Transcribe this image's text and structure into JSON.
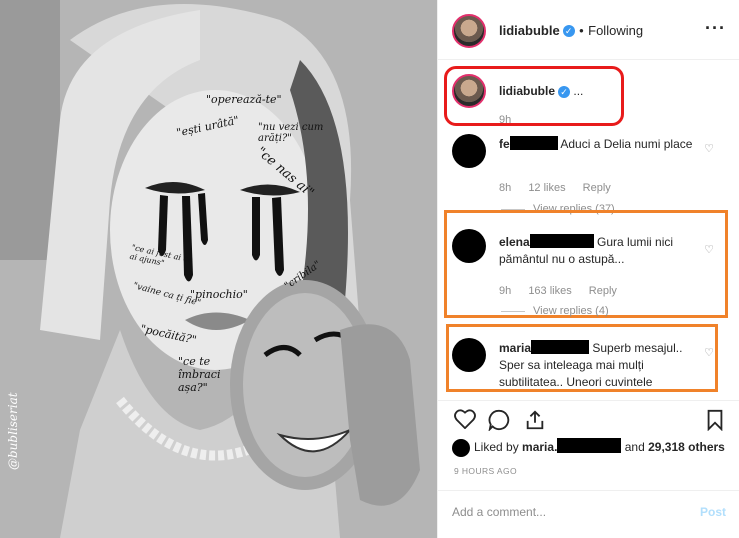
{
  "photo": {
    "face_text": [
      "\"operează-te\"",
      "\"ești urâtă\"",
      "\"nu vezi cum arăți?\"",
      "\"ce nas ai\"",
      "\"ce ai fost ai ce ai ajuns\"",
      "\"vaine ca ți fie\"",
      "\"pinochio\"",
      "\"cribila\"",
      "\"pocăită?\"",
      "\"ce te îmbraci așa?\""
    ],
    "watermark": "@bubliseriat"
  },
  "header": {
    "username": "lidiabuble",
    "separator": "•",
    "following": "Following",
    "more_icon": "more-horizontal-icon"
  },
  "caption": {
    "username": "lidiabuble",
    "text": "...",
    "time": "9h"
  },
  "comments": [
    {
      "user": "fe",
      "text": "Aduci a Delia numi place",
      "time": "8h",
      "likes": "12 likes",
      "reply": "Reply",
      "view_replies": "View replies (37)"
    },
    {
      "user": "elena",
      "text": "Gura lumii nici pământul nu o astupă...",
      "time": "9h",
      "likes": "163 likes",
      "reply": "Reply",
      "view_replies": "View replies (4)"
    },
    {
      "user": "maria",
      "text": "Superb mesajul.. Sper sa inteleaga mai mulți subtilitatea.. Uneori cuvintele"
    }
  ],
  "actions": {
    "like_icon": "heart-icon",
    "comment_icon": "comment-icon",
    "share_icon": "share-icon",
    "save_icon": "bookmark-icon"
  },
  "likes": {
    "prefix": "Liked by",
    "user": "maria.",
    "and": "and",
    "others": "29,318 others"
  },
  "time_ago": "9 HOURS AGO",
  "add_comment": {
    "placeholder": "Add a comment...",
    "post_label": "Post"
  },
  "colors": {
    "highlight_red": "#e81b1b",
    "highlight_orange": "#f0822a",
    "verified_blue": "#3897f0",
    "post_disabled": "#b2dffc"
  }
}
